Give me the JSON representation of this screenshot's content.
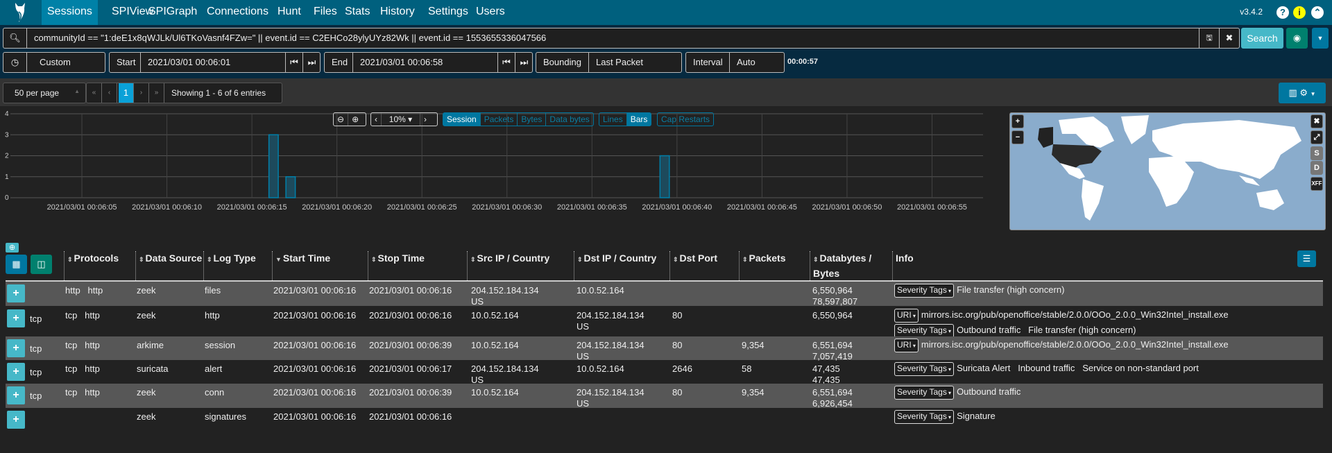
{
  "nav": {
    "items": [
      "Sessions",
      "SPIView",
      "SPIGraph",
      "Connections",
      "Hunt",
      "Files",
      "Stats",
      "History",
      "Settings",
      "Users"
    ],
    "active": "Sessions",
    "version": "v3.4.2",
    "accent": "#00607e"
  },
  "search": {
    "query": "communityId == \"1:deE1x8qWJLk/Ul6TKoVasnf4FZw=\" || event.id == C2EHCo28ylyUYz82Wk || event.id == 1553655336047566",
    "button": "Search"
  },
  "time": {
    "range": "Custom",
    "start_label": "Start",
    "start": "2021/03/01 00:06:01",
    "end_label": "End",
    "end": "2021/03/01 00:06:58",
    "bounding_label": "Bounding",
    "bounding": "Last Packet",
    "interval_label": "Interval",
    "interval": "Auto",
    "duration": "00:00:57"
  },
  "pager": {
    "per_page": "50 per page",
    "first": "«",
    "prev": "‹",
    "page": "1",
    "next": "›",
    "last": "»",
    "showing": "Showing 1 - 6 of 6 entries"
  },
  "chart_controls": {
    "zoom_pct": "10%",
    "metrics": [
      "Session",
      "Packets",
      "Bytes",
      "Data bytes"
    ],
    "active_metric": "Session",
    "styles": [
      "Lines",
      "Bars"
    ],
    "active_style": "Bars",
    "cap": "Cap Restarts"
  },
  "chart_data": {
    "type": "bar",
    "xlim": [
      "2021/03/01 00:06:01",
      "2021/03/01 00:06:58"
    ],
    "ylim": [
      0,
      4
    ],
    "yticks": [
      "0",
      "1",
      "2",
      "3",
      "4"
    ],
    "xticks": [
      "2021/03/01 00:06:05",
      "2021/03/01 00:06:10",
      "2021/03/01 00:06:15",
      "2021/03/01 00:06:20",
      "2021/03/01 00:06:25",
      "2021/03/01 00:06:30",
      "2021/03/01 00:06:35",
      "2021/03/01 00:06:40",
      "2021/03/01 00:06:45",
      "2021/03/01 00:06:50",
      "2021/03/01 00:06:55"
    ],
    "x": [
      "2021/03/01 00:06:16",
      "2021/03/01 00:06:17",
      "2021/03/01 00:06:39"
    ],
    "values": [
      3,
      1,
      2
    ],
    "grid": true,
    "color": "#0077a0"
  },
  "map": {
    "highlighted": "US",
    "buttons": [
      "+",
      "−",
      "✖",
      "⤢",
      "S",
      "D",
      "XFF"
    ]
  },
  "table": {
    "columns": [
      "Protocols",
      "Data Source",
      "Log Type",
      "Start Time",
      "Stop Time",
      "Src IP / Country",
      "Dst IP / Country",
      "Dst Port",
      "Packets",
      "Databytes / Bytes",
      "Info"
    ],
    "rows": [
      {
        "proto": "",
        "protos": "http   http",
        "source": "zeek",
        "type": "files",
        "start": "2021/03/01 00:06:16",
        "stop": "2021/03/01 00:06:16",
        "src": "204.152.184.134",
        "srcc": "US",
        "dst": "10.0.52.164",
        "dstc": "",
        "port": "",
        "packets": "",
        "db": "6,550,964",
        "bytes": "78,597,807",
        "info": [
          {
            "tag": "Severity Tags",
            "text": "File transfer (high concern)"
          }
        ]
      },
      {
        "proto": "tcp",
        "protos": "tcp   http",
        "source": "zeek",
        "type": "http",
        "start": "2021/03/01 00:06:16",
        "stop": "2021/03/01 00:06:16",
        "src": "10.0.52.164",
        "srcc": "",
        "dst": "204.152.184.134",
        "dstc": "US",
        "port": "80",
        "packets": "",
        "db": "6,550,964",
        "bytes": "",
        "info": [
          {
            "tag": "URI",
            "text": "mirrors.isc.org/pub/openoffice/stable/2.0.0/OOo_2.0.0_Win32Intel_install.exe"
          },
          {
            "tag": "Severity Tags",
            "text": "Outbound traffic   File transfer (high concern)"
          }
        ]
      },
      {
        "proto": "tcp",
        "protos": "tcp   http",
        "source": "arkime",
        "type": "session",
        "start": "2021/03/01 00:06:16",
        "stop": "2021/03/01 00:06:39",
        "src": "10.0.52.164",
        "srcc": "",
        "dst": "204.152.184.134",
        "dstc": "US",
        "port": "80",
        "packets": "9,354",
        "db": "6,551,694",
        "bytes": "7,057,419",
        "info": [
          {
            "tag": "URI",
            "text": "mirrors.isc.org/pub/openoffice/stable/2.0.0/OOo_2.0.0_Win32Intel_install.exe"
          }
        ]
      },
      {
        "proto": "tcp",
        "protos": "tcp   http",
        "source": "suricata",
        "type": "alert",
        "start": "2021/03/01 00:06:16",
        "stop": "2021/03/01 00:06:17",
        "src": "204.152.184.134",
        "srcc": "US",
        "dst": "10.0.52.164",
        "dstc": "",
        "port": "2646",
        "packets": "58",
        "db": "47,435",
        "bytes": "47,435",
        "info": [
          {
            "tag": "Severity Tags",
            "text": "Suricata Alert   Inbound traffic   Service on non-standard port"
          }
        ]
      },
      {
        "proto": "tcp",
        "protos": "tcp   http",
        "source": "zeek",
        "type": "conn",
        "start": "2021/03/01 00:06:16",
        "stop": "2021/03/01 00:06:39",
        "src": "10.0.52.164",
        "srcc": "",
        "dst": "204.152.184.134",
        "dstc": "US",
        "port": "80",
        "packets": "9,354",
        "db": "6,551,694",
        "bytes": "6,926,454",
        "info": [
          {
            "tag": "Severity Tags",
            "text": "Outbound traffic"
          }
        ]
      },
      {
        "proto": "",
        "protos": "",
        "source": "zeek",
        "type": "signatures",
        "start": "2021/03/01 00:06:16",
        "stop": "2021/03/01 00:06:16",
        "src": "",
        "srcc": "",
        "dst": "",
        "dstc": "",
        "port": "",
        "packets": "",
        "db": "",
        "bytes": "",
        "info": [
          {
            "tag": "Severity Tags",
            "text": "Signature"
          }
        ]
      }
    ]
  }
}
